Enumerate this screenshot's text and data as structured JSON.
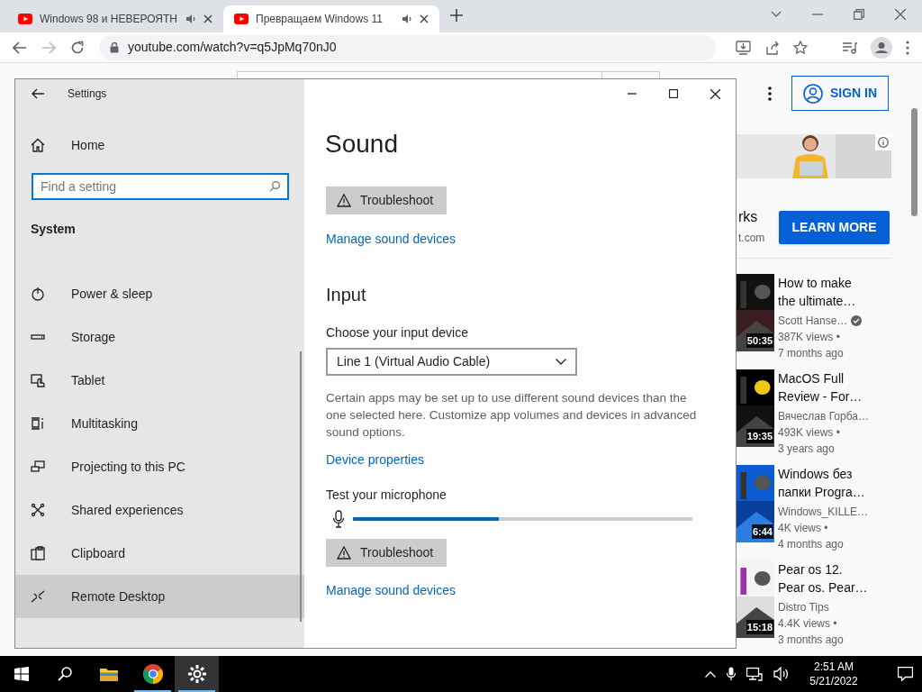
{
  "browser": {
    "tabs": [
      {
        "title": "Windows 98 и НЕВЕРОЯТН",
        "selected": false
      },
      {
        "title": "Превращаем Windows 11",
        "selected": true
      }
    ],
    "url": "youtube.com/watch?v=q5JpMq70nJ0"
  },
  "youtube": {
    "sign_in": "SIGN IN",
    "ad": {
      "kind": "picture",
      "title": "rks",
      "domain": "t.com",
      "button": "LEARN MORE"
    },
    "videos": [
      {
        "title": "How to make the ultimate…",
        "channel": "Scott Hanse…",
        "verified": true,
        "views": "387K views •",
        "age": "7 months ago",
        "duration": "50:35"
      },
      {
        "title": "MacOS Full Review - For…",
        "channel": "Вячеслав Горба…",
        "verified": false,
        "views": "493K views •",
        "age": "3 years ago",
        "duration": "19:35"
      },
      {
        "title": "Windows без папки Progra…",
        "channel": "Windows_KILLE…",
        "verified": false,
        "views": "4K views •",
        "age": "4 months ago",
        "duration": "6:44"
      },
      {
        "title": "Pear os 12. Pear os. Pear…",
        "channel": "Distro Tips",
        "verified": false,
        "views": "4.4K views •",
        "age": "3 months ago",
        "duration": "15:18"
      }
    ]
  },
  "settings": {
    "title": "Settings",
    "home": "Home",
    "search": {
      "placeholder": "Find a setting"
    },
    "section": "System",
    "items": [
      {
        "label": "Power & sleep",
        "selected": false
      },
      {
        "label": "Storage",
        "selected": false
      },
      {
        "label": "Tablet",
        "selected": false
      },
      {
        "label": "Multitasking",
        "selected": false
      },
      {
        "label": "Projecting to this PC",
        "selected": false
      },
      {
        "label": "Shared experiences",
        "selected": false
      },
      {
        "label": "Clipboard",
        "selected": false
      },
      {
        "label": "Remote Desktop",
        "selected": true
      }
    ],
    "page": {
      "title": "Sound",
      "output_troubleshoot": "Troubleshoot",
      "output_manage": "Manage sound devices",
      "input_heading": "Input",
      "choose_label": "Choose your input device",
      "input_device": "Line 1 (Virtual Audio Cable)",
      "note": "Certain apps may be set up to use different sound devices than the one selected here. Customize app volumes and devices in advanced sound options.",
      "device_properties": "Device properties",
      "test_label": "Test your microphone",
      "mic": {
        "level": 0.43
      },
      "input_troubleshoot": "Troubleshoot",
      "input_manage": "Manage sound devices"
    }
  },
  "taskbar": {
    "apps": [
      {
        "running": false,
        "selected": false
      },
      {
        "running": true,
        "selected": false
      },
      {
        "running": true,
        "selected": true
      }
    ],
    "time": "2:51 AM",
    "date": "5/21/2022"
  }
}
